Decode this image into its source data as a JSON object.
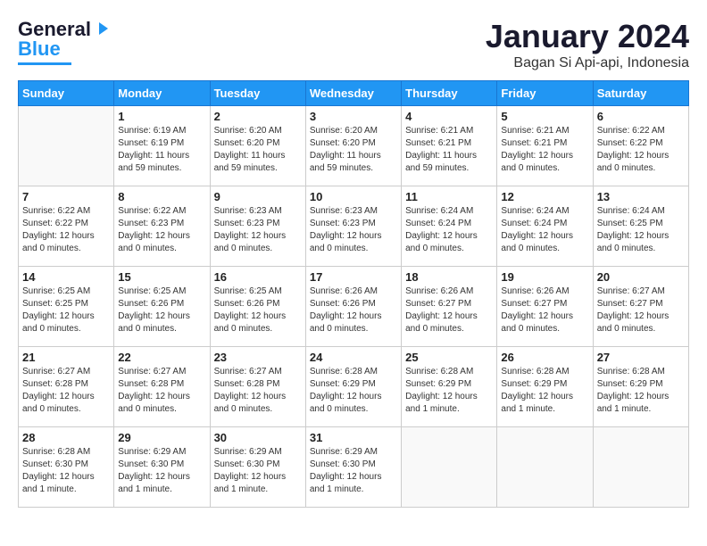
{
  "header": {
    "logo_general": "General",
    "logo_blue": "Blue",
    "title": "January 2024",
    "subtitle": "Bagan Si Api-api, Indonesia"
  },
  "weekdays": [
    "Sunday",
    "Monday",
    "Tuesday",
    "Wednesday",
    "Thursday",
    "Friday",
    "Saturday"
  ],
  "weeks": [
    [
      {
        "day": "",
        "info": ""
      },
      {
        "day": "1",
        "info": "Sunrise: 6:19 AM\nSunset: 6:19 PM\nDaylight: 11 hours\nand 59 minutes."
      },
      {
        "day": "2",
        "info": "Sunrise: 6:20 AM\nSunset: 6:20 PM\nDaylight: 11 hours\nand 59 minutes."
      },
      {
        "day": "3",
        "info": "Sunrise: 6:20 AM\nSunset: 6:20 PM\nDaylight: 11 hours\nand 59 minutes."
      },
      {
        "day": "4",
        "info": "Sunrise: 6:21 AM\nSunset: 6:21 PM\nDaylight: 11 hours\nand 59 minutes."
      },
      {
        "day": "5",
        "info": "Sunrise: 6:21 AM\nSunset: 6:21 PM\nDaylight: 12 hours\nand 0 minutes."
      },
      {
        "day": "6",
        "info": "Sunrise: 6:22 AM\nSunset: 6:22 PM\nDaylight: 12 hours\nand 0 minutes."
      }
    ],
    [
      {
        "day": "7",
        "info": "Sunrise: 6:22 AM\nSunset: 6:22 PM\nDaylight: 12 hours\nand 0 minutes."
      },
      {
        "day": "8",
        "info": "Sunrise: 6:22 AM\nSunset: 6:23 PM\nDaylight: 12 hours\nand 0 minutes."
      },
      {
        "day": "9",
        "info": "Sunrise: 6:23 AM\nSunset: 6:23 PM\nDaylight: 12 hours\nand 0 minutes."
      },
      {
        "day": "10",
        "info": "Sunrise: 6:23 AM\nSunset: 6:23 PM\nDaylight: 12 hours\nand 0 minutes."
      },
      {
        "day": "11",
        "info": "Sunrise: 6:24 AM\nSunset: 6:24 PM\nDaylight: 12 hours\nand 0 minutes."
      },
      {
        "day": "12",
        "info": "Sunrise: 6:24 AM\nSunset: 6:24 PM\nDaylight: 12 hours\nand 0 minutes."
      },
      {
        "day": "13",
        "info": "Sunrise: 6:24 AM\nSunset: 6:25 PM\nDaylight: 12 hours\nand 0 minutes."
      }
    ],
    [
      {
        "day": "14",
        "info": "Sunrise: 6:25 AM\nSunset: 6:25 PM\nDaylight: 12 hours\nand 0 minutes."
      },
      {
        "day": "15",
        "info": "Sunrise: 6:25 AM\nSunset: 6:26 PM\nDaylight: 12 hours\nand 0 minutes."
      },
      {
        "day": "16",
        "info": "Sunrise: 6:25 AM\nSunset: 6:26 PM\nDaylight: 12 hours\nand 0 minutes."
      },
      {
        "day": "17",
        "info": "Sunrise: 6:26 AM\nSunset: 6:26 PM\nDaylight: 12 hours\nand 0 minutes."
      },
      {
        "day": "18",
        "info": "Sunrise: 6:26 AM\nSunset: 6:27 PM\nDaylight: 12 hours\nand 0 minutes."
      },
      {
        "day": "19",
        "info": "Sunrise: 6:26 AM\nSunset: 6:27 PM\nDaylight: 12 hours\nand 0 minutes."
      },
      {
        "day": "20",
        "info": "Sunrise: 6:27 AM\nSunset: 6:27 PM\nDaylight: 12 hours\nand 0 minutes."
      }
    ],
    [
      {
        "day": "21",
        "info": "Sunrise: 6:27 AM\nSunset: 6:28 PM\nDaylight: 12 hours\nand 0 minutes."
      },
      {
        "day": "22",
        "info": "Sunrise: 6:27 AM\nSunset: 6:28 PM\nDaylight: 12 hours\nand 0 minutes."
      },
      {
        "day": "23",
        "info": "Sunrise: 6:27 AM\nSunset: 6:28 PM\nDaylight: 12 hours\nand 0 minutes."
      },
      {
        "day": "24",
        "info": "Sunrise: 6:28 AM\nSunset: 6:29 PM\nDaylight: 12 hours\nand 0 minutes."
      },
      {
        "day": "25",
        "info": "Sunrise: 6:28 AM\nSunset: 6:29 PM\nDaylight: 12 hours\nand 1 minute."
      },
      {
        "day": "26",
        "info": "Sunrise: 6:28 AM\nSunset: 6:29 PM\nDaylight: 12 hours\nand 1 minute."
      },
      {
        "day": "27",
        "info": "Sunrise: 6:28 AM\nSunset: 6:29 PM\nDaylight: 12 hours\nand 1 minute."
      }
    ],
    [
      {
        "day": "28",
        "info": "Sunrise: 6:28 AM\nSunset: 6:30 PM\nDaylight: 12 hours\nand 1 minute."
      },
      {
        "day": "29",
        "info": "Sunrise: 6:29 AM\nSunset: 6:30 PM\nDaylight: 12 hours\nand 1 minute."
      },
      {
        "day": "30",
        "info": "Sunrise: 6:29 AM\nSunset: 6:30 PM\nDaylight: 12 hours\nand 1 minute."
      },
      {
        "day": "31",
        "info": "Sunrise: 6:29 AM\nSunset: 6:30 PM\nDaylight: 12 hours\nand 1 minute."
      },
      {
        "day": "",
        "info": ""
      },
      {
        "day": "",
        "info": ""
      },
      {
        "day": "",
        "info": ""
      }
    ]
  ]
}
